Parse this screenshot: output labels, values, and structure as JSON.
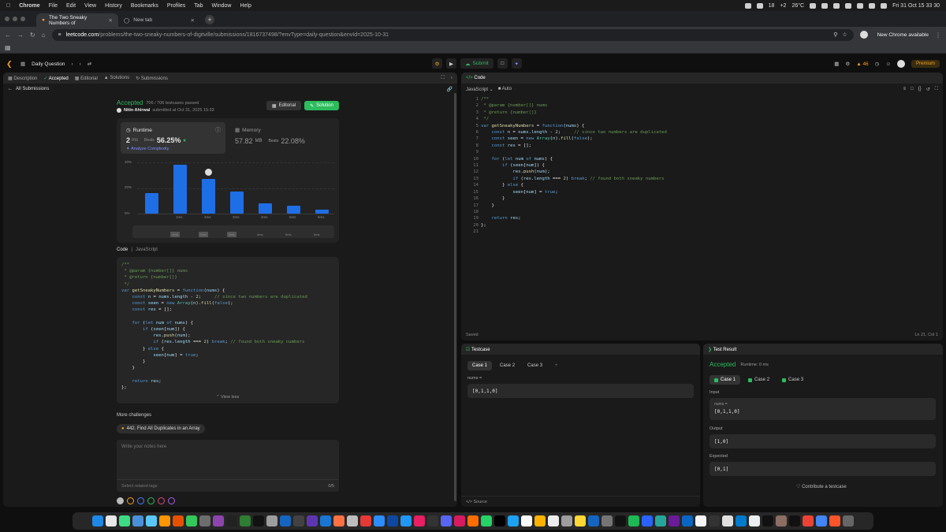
{
  "menubar": {
    "apple_icon": "apple-icon",
    "items": [
      "Chrome",
      "File",
      "Edit",
      "View",
      "History",
      "Bookmarks",
      "Profiles",
      "Tab",
      "Window",
      "Help"
    ],
    "status": [
      "18",
      "+2",
      "26°C"
    ],
    "clock": "Fri 31 Oct  15 33 30"
  },
  "tabs": [
    {
      "title": "The Two Sneaky Numbers of",
      "active": true
    },
    {
      "title": "New tab",
      "active": false
    }
  ],
  "toolbar": {
    "url_host": "leetcode.com",
    "url_path": "/problems/the-two-sneaky-numbers-of-digitville/submissions/1816737498/?envType=daily-question&envId=2025-10-31",
    "chrome_update": "New Chrome available"
  },
  "lcnav": {
    "daily": "Daily Question",
    "submit": "Submit",
    "streak": "46",
    "premium": "Premium"
  },
  "left": {
    "tabs": [
      "Description",
      "Accepted",
      "Editorial",
      "Solutions",
      "Submissions"
    ],
    "all_submissions": "All Submissions",
    "status": "Accepted",
    "testcases": "706 / 706 testcases passed",
    "author": "Nitin Ahirwal",
    "submitted": "submitted at Oct 31, 2025 15:33",
    "editorial_btn": "Editorial",
    "solution_btn": "Solution",
    "runtime": {
      "label": "Runtime",
      "value": "2",
      "unit": "ms",
      "beats_label": "Beats",
      "beats": "56.25%",
      "analyze": "Analyze Complexity"
    },
    "memory": {
      "label": "Memory",
      "value": "57.82",
      "unit": "MB",
      "beats_label": "Beats",
      "beats": "22.08%"
    },
    "code_label": "Code",
    "lang": "JavaScript",
    "view_less": "View less",
    "more": "More challenges",
    "related": "442. Find All Duplicates in an Array",
    "notes_placeholder": "Write your notes here",
    "tags_placeholder": "Select related tags",
    "notes_count": "0/5"
  },
  "chart_data": {
    "type": "bar",
    "ylabel": "",
    "ytick_labels": [
      "40%",
      "20%",
      "0%"
    ],
    "ylim": [
      0,
      40
    ],
    "categories": [
      "0ms",
      "1ms",
      "2ms",
      "3ms",
      "4ms",
      "5ms",
      "6ms"
    ],
    "xtick_labels": [
      "1ms",
      "2ms",
      "3ms",
      "4ms",
      "5ms",
      "6ms"
    ],
    "values": [
      16,
      38,
      27,
      17,
      8,
      6,
      3
    ],
    "highlight": "2ms",
    "minimap_labels": [
      "1ms",
      "2ms",
      "3ms",
      "4ms",
      "5ms",
      "6ms"
    ]
  },
  "editor": {
    "title": "Code",
    "lang": "JavaScript",
    "mode": "Auto",
    "saved": "Saved",
    "pos": "Ln 21, Col 1"
  },
  "testcase": {
    "title": "Testcase",
    "cases": [
      "Case 1",
      "Case 2",
      "Case 3"
    ],
    "input_label": "nums =",
    "input": "[0,1,1,0]",
    "source": "Source"
  },
  "result": {
    "title": "Test Result",
    "status": "Accepted",
    "runtime": "Runtime: 0 ms",
    "cases": [
      "Case 1",
      "Case 2",
      "Case 3"
    ],
    "input_section": "Input",
    "input_label": "nums =",
    "input": "[0,1,1,0]",
    "output_section": "Output",
    "output": "[1,0]",
    "expected_section": "Expected",
    "expected": "[0,1]",
    "contribute": "Contribute a testcase"
  },
  "colors": {
    "accent_green": "#2cbb5d",
    "bar_blue": "#1e6ee6",
    "leetcode_orange": "#f89f1b"
  }
}
